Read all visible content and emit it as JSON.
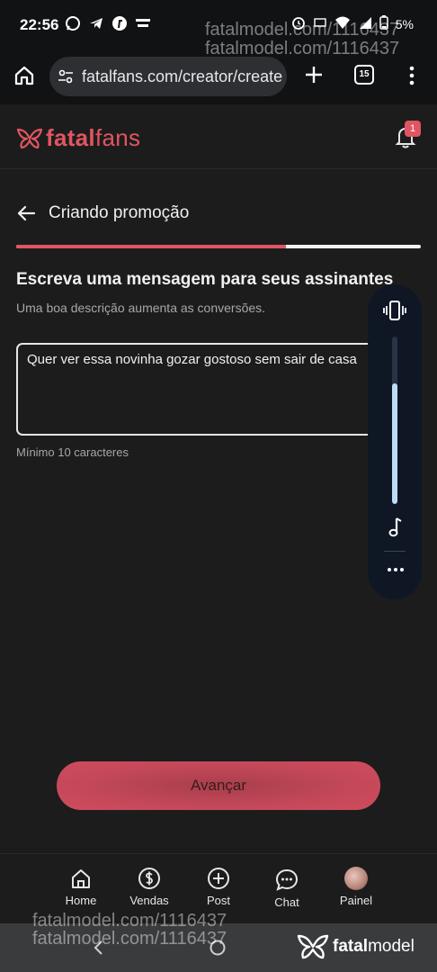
{
  "status_bar": {
    "time": "22:56",
    "left_icons": [
      "whatsapp-icon",
      "telegram-icon",
      "f-app-icon",
      "globoplay-icon"
    ],
    "right_icons": [
      "alarm-icon",
      "volte-icon",
      "wifi-icon",
      "signal-icon",
      "battery-icon"
    ],
    "battery_text": "5%"
  },
  "watermarks": {
    "top_line1": "fatalmodel.com/1116437",
    "top_line2": "fatalmodel.com/1116437",
    "bottom_line1": "fatalmodel.com/1116437",
    "bottom_line2": "fatalmodel.com/1116437"
  },
  "browser": {
    "url": "fatalfans.com/creator/create",
    "tab_count": "15"
  },
  "app": {
    "logo_bold": "fatal",
    "logo_light": "fans",
    "notification_count": "1"
  },
  "page": {
    "title": "Criando promoção",
    "progress": 0.667,
    "section_title": "Escreva uma mensagem para seus assinantes",
    "section_subtitle": "Uma boa descrição aumenta as conversões.",
    "message_value": "Quer ver essa novinha gozar gostoso sem sair de casa",
    "hint": "Mínimo 10 caracteres",
    "advance_label": "Avançar"
  },
  "volume_panel": {
    "level": 0.72,
    "icons": [
      "vibrate-icon",
      "music-note-icon",
      "more-dots-icon"
    ]
  },
  "bottom_nav": {
    "items": [
      {
        "label": "Home",
        "icon": "home-icon"
      },
      {
        "label": "Vendas",
        "icon": "dollar-circle-icon"
      },
      {
        "label": "Post",
        "icon": "plus-circle-icon"
      },
      {
        "label": "Chat",
        "icon": "chat-bubble-icon"
      },
      {
        "label": "Painel",
        "icon": "avatar"
      }
    ]
  },
  "brand_mark": {
    "bold": "fatal",
    "light": "model"
  },
  "colors": {
    "accent": "#e05561",
    "background": "#1c1c1c",
    "button": "#c4485a"
  }
}
